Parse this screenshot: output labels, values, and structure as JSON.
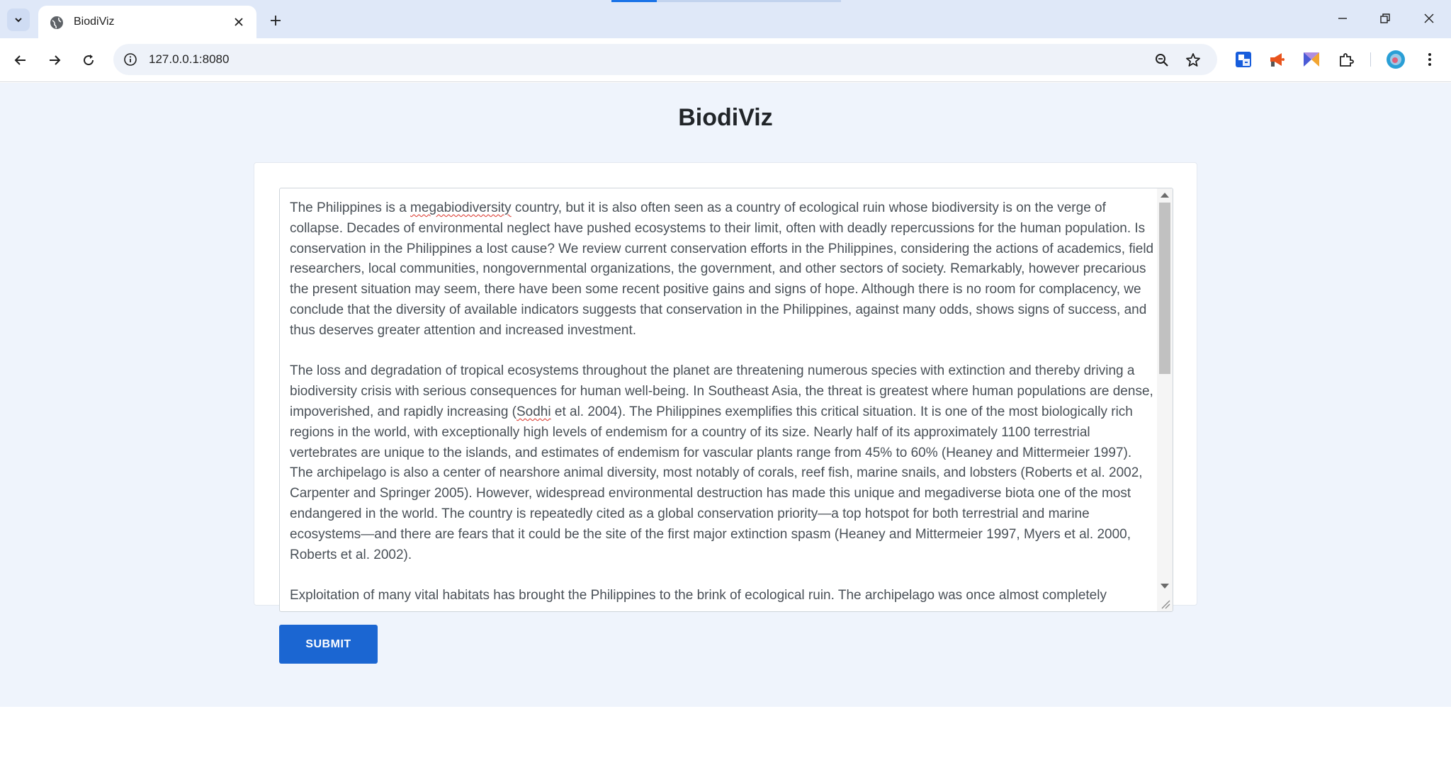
{
  "browser": {
    "tab_title": "BiodiViz",
    "url": "127.0.0.1:8080",
    "accent_color": "#1a73e8"
  },
  "page": {
    "title": "BiodiViz",
    "submit_label": "SUBMIT",
    "textarea": {
      "paragraphs": [
        {
          "before": "The Philippines is a ",
          "misspelled": "megabiodiversity",
          "after": " country, but it is also often seen as a country of ecological ruin whose biodiversity is on the verge of collapse. Decades of environmental neglect have pushed ecosystems to their limit, often with deadly repercussions for the human population. Is conservation in the Philippines a lost cause? We review current conservation efforts in the Philippines, considering the actions of academics, field researchers, local communities, nongovernmental organizations, the government, and other sectors of society. Remarkably, however precarious the present situation may seem, there have been some recent positive gains and signs of hope. Although there is no room for complacency, we conclude that the diversity of available indicators suggests that conservation in the Philippines, against many odds, shows signs of success, and thus deserves greater attention and increased investment."
        },
        {
          "before": "The loss and degradation of tropical ecosystems throughout the planet are threatening numerous species with extinction and thereby driving a biodiversity crisis with serious consequences for human well-being. In Southeast Asia, the threat is greatest where human populations are dense, impoverished, and rapidly increasing (",
          "misspelled": "Sodhi",
          "after": " et al. 2004). The Philippines exemplifies this critical situation. It is one of the most biologically rich regions in the world, with exceptionally high levels of endemism for a country of its size. Nearly half of its approximately 1100 terrestrial vertebrates are unique to the islands, and estimates of endemism for vascular plants range from 45% to 60% (Heaney and Mittermeier 1997). The archipelago is also a center of nearshore animal diversity, most notably of corals, reef fish, marine snails, and lobsters (Roberts et al. 2002, Carpenter and Springer 2005). However, widespread environmental destruction has made this unique and megadiverse biota one of the most endangered in the world. The country is repeatedly cited as a global conservation priority—a top hotspot for both terrestrial and marine ecosystems—and there are fears that it could be the site of the first major extinction spasm (Heaney and Mittermeier 1997, Myers et al. 2000, Roberts et al. 2002)."
        },
        {
          "before": "Exploitation of many vital habitats has brought the Philippines to the brink of ecological ruin. The archipelago was once almost completely",
          "misspelled": "",
          "after": ""
        }
      ]
    }
  }
}
